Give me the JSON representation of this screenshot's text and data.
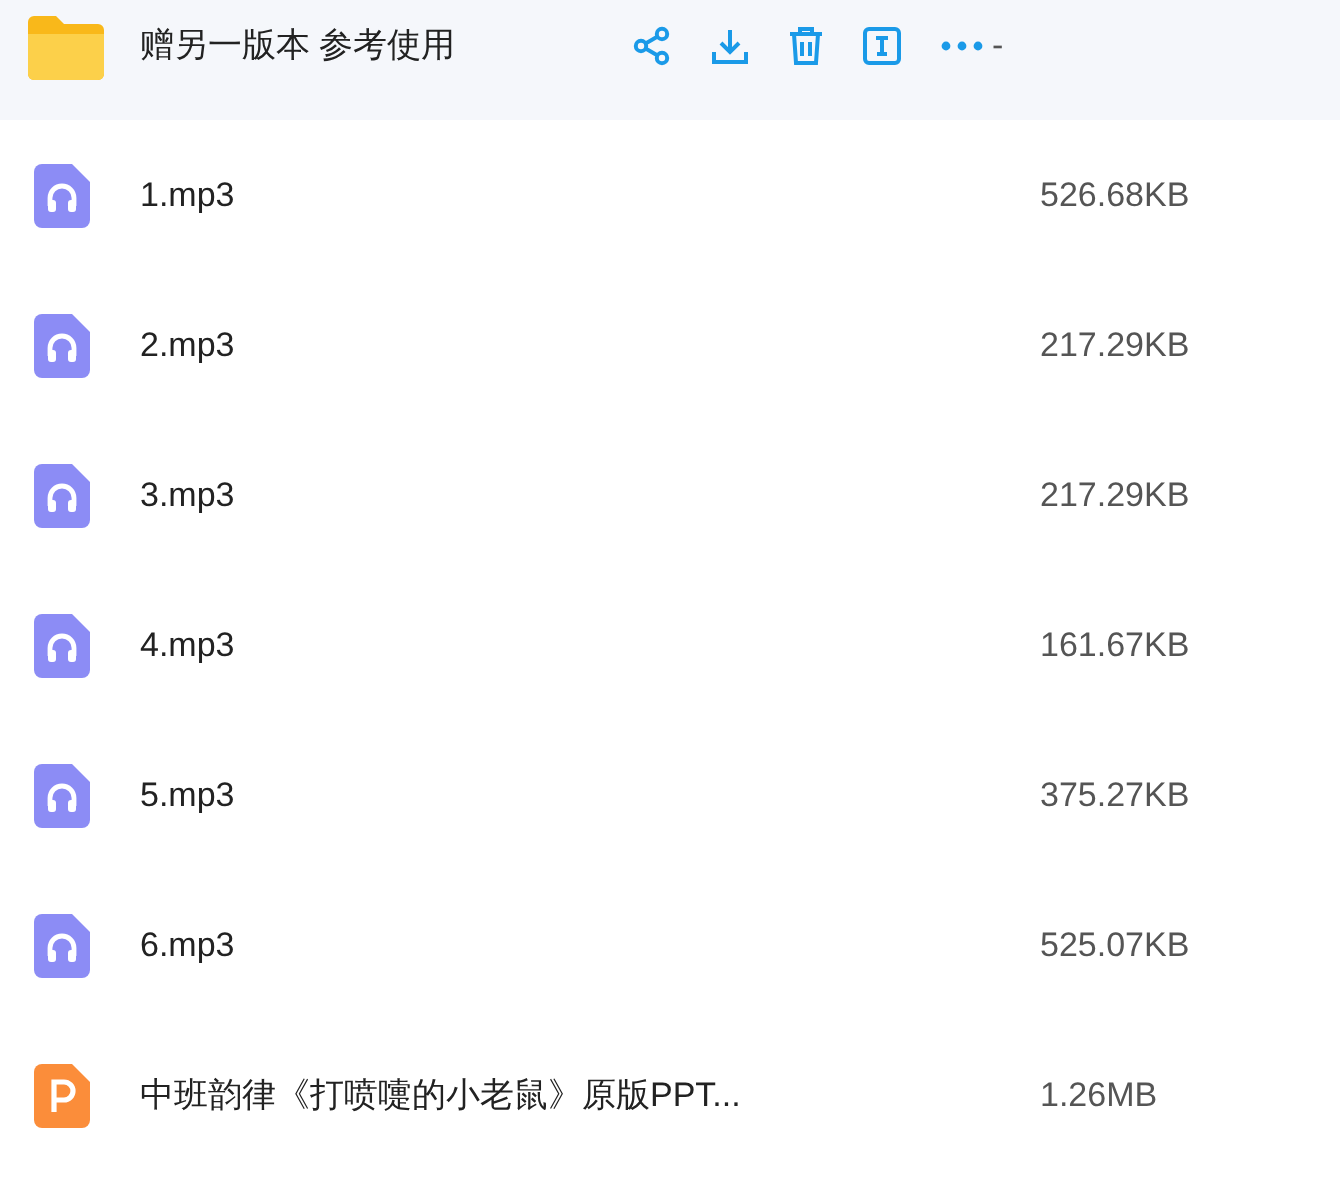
{
  "files": [
    {
      "kind": "folder",
      "name": "赠另一版本 参考使用",
      "size": "-",
      "selected": true
    },
    {
      "kind": "audio",
      "name": "1.mp3",
      "size": "526.68KB",
      "selected": false
    },
    {
      "kind": "audio",
      "name": "2.mp3",
      "size": "217.29KB",
      "selected": false
    },
    {
      "kind": "audio",
      "name": "3.mp3",
      "size": "217.29KB",
      "selected": false
    },
    {
      "kind": "audio",
      "name": "4.mp3",
      "size": "161.67KB",
      "selected": false
    },
    {
      "kind": "audio",
      "name": "5.mp3",
      "size": "375.27KB",
      "selected": false
    },
    {
      "kind": "audio",
      "name": "6.mp3",
      "size": "525.07KB",
      "selected": false
    },
    {
      "kind": "ppt",
      "name": "中班韵律《打喷嚏的小老鼠》原版PPT...",
      "size": "1.26MB",
      "selected": false
    }
  ]
}
